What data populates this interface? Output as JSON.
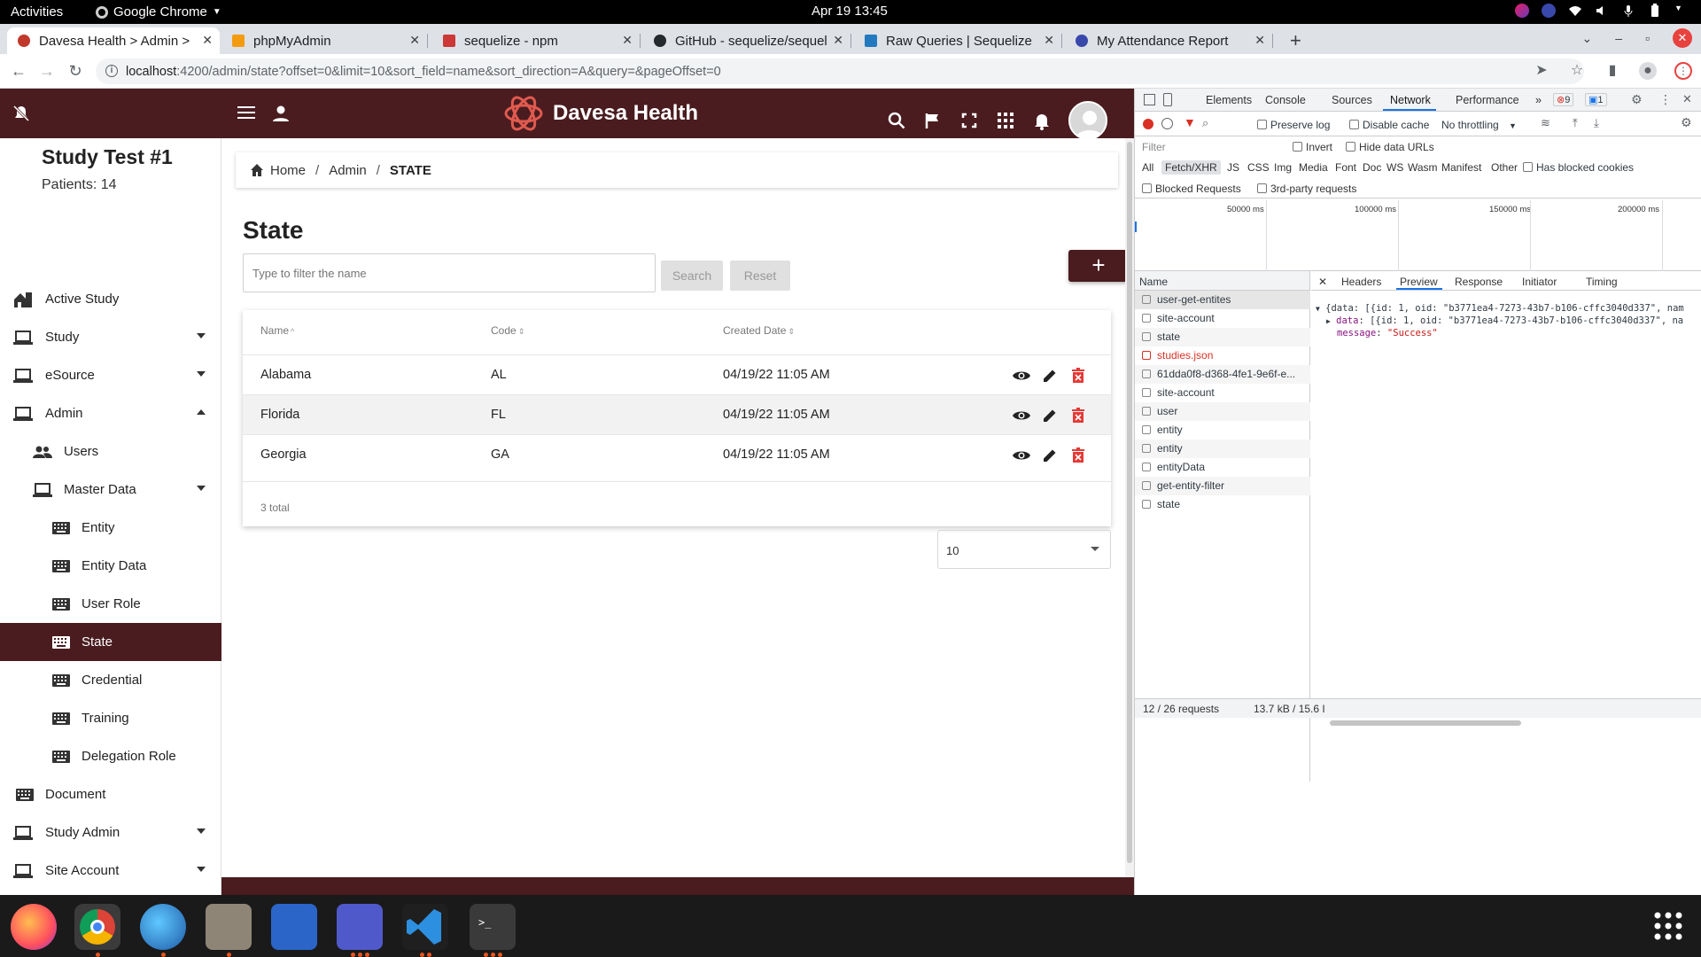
{
  "os": {
    "activities": "Activities",
    "app_name": "Google Chrome",
    "clock": "Apr 19  13:45"
  },
  "browser": {
    "tabs": [
      {
        "title": "Davesa Health > Admin > S",
        "favicon_color": "#c0392b"
      },
      {
        "title": "phpMyAdmin",
        "favicon_color": "#f39c12"
      },
      {
        "title": "sequelize - npm",
        "favicon_color": "#cb3837"
      },
      {
        "title": "GitHub - sequelize/sequel",
        "favicon_color": "#24292e"
      },
      {
        "title": "Raw Queries | Sequelize",
        "favicon_color": "#2379bd"
      },
      {
        "title": "My Attendance Report",
        "favicon_color": "#3949ab"
      }
    ],
    "url_host": "localhost",
    "url_rest": ":4200/admin/state?offset=0&limit=10&sort_field=name&sort_direction=A&query=&pageOffset=0"
  },
  "app": {
    "brand": "Davesa Health",
    "header_color": "#4a1c1f",
    "accent_red": "#e53935"
  },
  "sidebar": {
    "study_title": "Study Test #1",
    "patients": "Patients: 14",
    "items": [
      {
        "label": "Active Study",
        "icon": "home-work-icon"
      },
      {
        "label": "Study",
        "icon": "laptop-icon"
      },
      {
        "label": "eSource",
        "icon": "laptop-icon"
      },
      {
        "label": "Admin",
        "icon": "laptop-icon"
      },
      {
        "label": "Users",
        "icon": "people-icon"
      },
      {
        "label": "Master Data",
        "icon": "laptop-icon"
      },
      {
        "label": "Entity",
        "icon": "keyboard-icon"
      },
      {
        "label": "Entity Data",
        "icon": "keyboard-icon"
      },
      {
        "label": "User Role",
        "icon": "keyboard-icon"
      },
      {
        "label": "State",
        "icon": "keyboard-icon"
      },
      {
        "label": "Credential",
        "icon": "keyboard-icon"
      },
      {
        "label": "Training",
        "icon": "keyboard-icon"
      },
      {
        "label": "Delegation Role",
        "icon": "keyboard-icon"
      },
      {
        "label": "Document",
        "icon": "keyboard-icon"
      },
      {
        "label": "Study Admin",
        "icon": "laptop-icon"
      },
      {
        "label": "Site Account",
        "icon": "laptop-icon"
      }
    ]
  },
  "breadcrumb": {
    "home": "Home",
    "admin": "Admin",
    "current": "STATE",
    "sep": "/"
  },
  "page": {
    "title": "State",
    "filter_placeholder": "Type to filter the name",
    "search_label": "Search",
    "reset_label": "Reset",
    "add_label": "+"
  },
  "table": {
    "columns": [
      "Name",
      "Code",
      "Created Date"
    ],
    "sort_asc": "^",
    "sort_both": "⇕",
    "rows": [
      {
        "name": "Alabama",
        "code": "AL",
        "created": "04/19/22 11:05 AM"
      },
      {
        "name": "Florida",
        "code": "FL",
        "created": "04/19/22 11:05 AM"
      },
      {
        "name": "Georgia",
        "code": "GA",
        "created": "04/19/22 11:05 AM"
      }
    ],
    "total": "3 total",
    "page_size": "10"
  },
  "devtools": {
    "tabs": [
      "Elements",
      "Console",
      "Sources",
      "Network",
      "Performance"
    ],
    "more": "»",
    "errors": "9",
    "messages": "1",
    "preserve_log": "Preserve log",
    "disable_cache": "Disable cache",
    "throttling": "No throttling",
    "filter_placeholder": "Filter",
    "invert": "Invert",
    "hide_data_urls": "Hide data URLs",
    "types": [
      "All",
      "Fetch/XHR",
      "JS",
      "CSS",
      "Img",
      "Media",
      "Font",
      "Doc",
      "WS",
      "Wasm",
      "Manifest",
      "Other"
    ],
    "has_blocked_cookies": "Has blocked cookies",
    "blocked_requests": "Blocked Requests",
    "third_party": "3rd-party requests",
    "timeline_labels": [
      "50000 ms",
      "100000 ms",
      "150000 ms",
      "200000 ms"
    ],
    "name_header": "Name",
    "requests": [
      {
        "name": "user-get-entites",
        "error": false
      },
      {
        "name": "site-account",
        "error": false
      },
      {
        "name": "state",
        "error": false
      },
      {
        "name": "studies.json",
        "error": true
      },
      {
        "name": "61dda0f8-d368-4fe1-9e6f-e...",
        "error": false
      },
      {
        "name": "site-account",
        "error": false
      },
      {
        "name": "user",
        "error": false
      },
      {
        "name": "entity",
        "error": false
      },
      {
        "name": "entity",
        "error": false
      },
      {
        "name": "entityData",
        "error": false
      },
      {
        "name": "get-entity-filter",
        "error": false
      },
      {
        "name": "state",
        "error": false
      }
    ],
    "preview_tabs": [
      "Headers",
      "Preview",
      "Response",
      "Initiator",
      "Timing"
    ],
    "preview_line1": "{data: [{id: 1, oid: \"b3771ea4-7273-43b7-b106-cffc3040d337\", nam",
    "preview_line2_key": "data",
    "preview_line2_val": "[{id: 1, oid: \"b3771ea4-7273-43b7-b106-cffc3040d337\", na",
    "preview_line3_key": "message",
    "preview_line3_val": "\"Success\"",
    "status_requests": "12 / 26 requests",
    "status_size": "13.7 kB / 15.6 I"
  }
}
